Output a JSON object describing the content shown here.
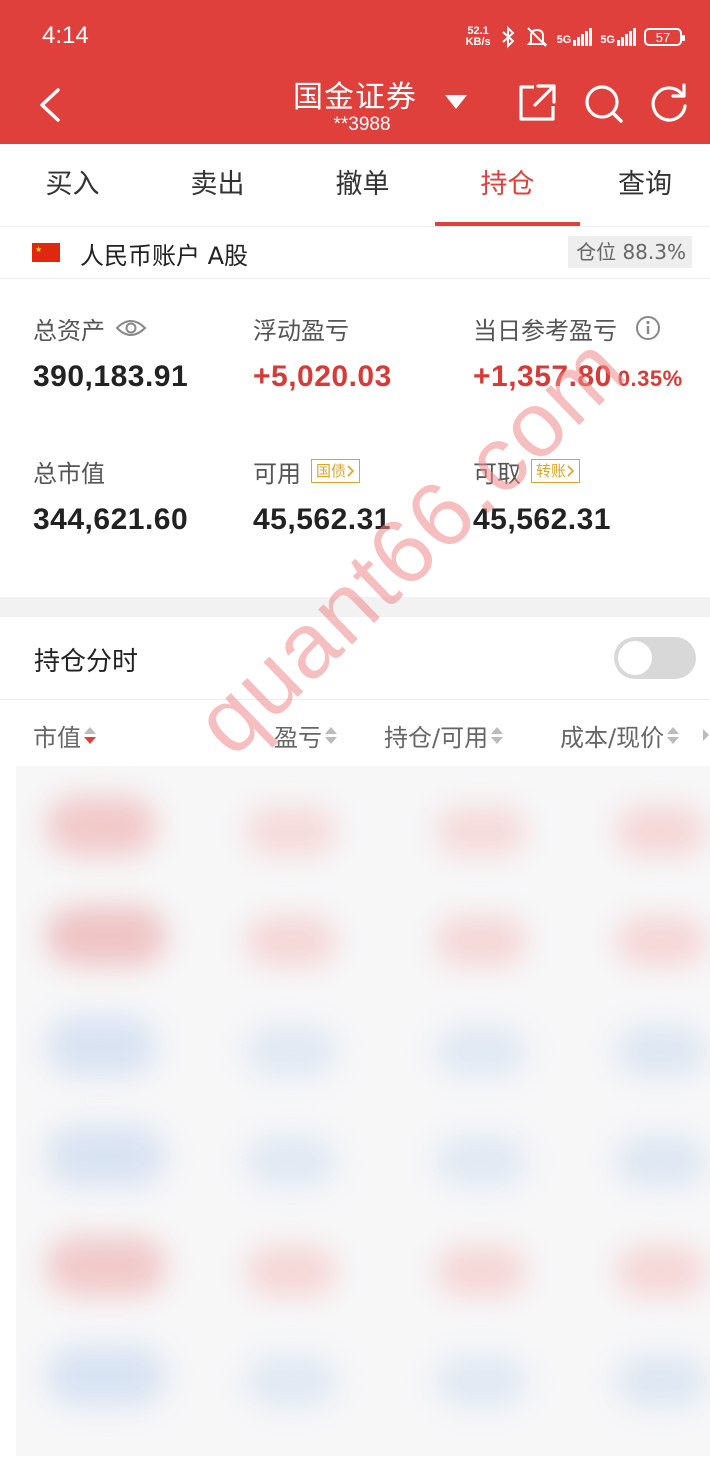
{
  "status": {
    "time": "4:14",
    "net_speed_value": "52.1",
    "net_speed_unit": "KB/s",
    "network_1": "5G",
    "network_2": "5G",
    "battery": "57"
  },
  "header": {
    "title": "国金证券",
    "account": "**3988",
    "bg_color": "#e0403b"
  },
  "tabs": [
    {
      "label": "买入",
      "active": false
    },
    {
      "label": "卖出",
      "active": false
    },
    {
      "label": "撤单",
      "active": false
    },
    {
      "label": "持仓",
      "active": true
    },
    {
      "label": "查询",
      "active": false
    }
  ],
  "account": {
    "label": "人民币账户 A股",
    "position_label": "仓位",
    "position_value": "88.3%"
  },
  "metrics": {
    "total_assets_label": "总资产",
    "total_assets_value": "390,183.91",
    "floating_pl_label": "浮动盈亏",
    "floating_pl_value": "+5,020.03",
    "daily_pl_label": "当日参考盈亏",
    "daily_pl_value": "+1,357.80",
    "daily_pl_pct": "0.35%",
    "market_value_label": "总市值",
    "market_value_value": "344,621.60",
    "available_label": "可用",
    "available_tag": "国债",
    "available_value": "45,562.31",
    "withdrawable_label": "可取",
    "withdrawable_tag": "转账",
    "withdrawable_value": "45,562.31"
  },
  "realtime": {
    "label": "持仓分时",
    "enabled": false
  },
  "columns": {
    "market_value": "市值",
    "profit_loss": "盈亏",
    "position_available": "持仓/可用",
    "cost_price": "成本/现价"
  },
  "watermark": "quant66.com"
}
